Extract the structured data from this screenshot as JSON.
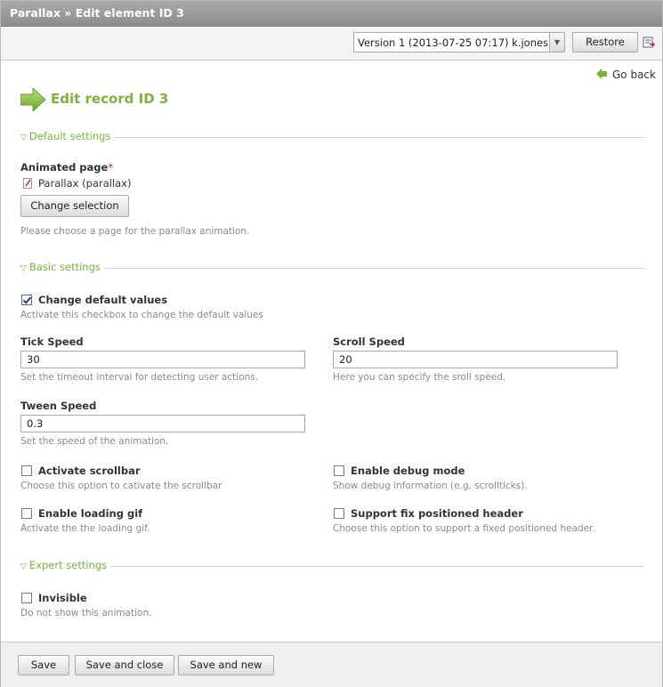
{
  "window": {
    "title": "Parallax » Edit element ID 3"
  },
  "toolbar": {
    "version_selected": "Version 1 (2013-07-25 07:17) k.jones",
    "restore_label": "Restore"
  },
  "nav": {
    "go_back": "Go back"
  },
  "page": {
    "title": "Edit record ID 3"
  },
  "sections": {
    "default": "Default settings",
    "basic": "Basic settings",
    "expert": "Expert settings"
  },
  "fields": {
    "animated_page": {
      "label": "Animated page",
      "required_mark": "*",
      "value": "Parallax (parallax)",
      "button": "Change selection",
      "help": "Please choose a page for the parallax animation."
    },
    "change_defaults": {
      "label": "Change default values",
      "checked": true,
      "help": "Activate this checkbox to change the default values"
    },
    "tick_speed": {
      "label": "Tick Speed",
      "value": "30",
      "help": "Set the timeout interval for detecting user actions."
    },
    "scroll_speed": {
      "label": "Scroll Speed",
      "value": "20",
      "help": "Here you can specify the sroll speed."
    },
    "tween_speed": {
      "label": "Tween Speed",
      "value": "0.3",
      "help": "Set the speed of the animation."
    },
    "scrollbar": {
      "label": "Activate scrollbar",
      "checked": false,
      "help": "Choose this option to cativate the scrollbar"
    },
    "debug": {
      "label": "Enable debug mode",
      "checked": false,
      "help": "Show debug information (e.g. scrollticks)."
    },
    "loading_gif": {
      "label": "Enable loading gif",
      "checked": false,
      "help": "Activate the the loading gif."
    },
    "fix_header": {
      "label": "Support fix positioned header",
      "checked": false,
      "help": "Choose this option to support a fixed positioned header."
    },
    "invisible": {
      "label": "Invisible",
      "checked": false,
      "help": "Do not show this animation."
    }
  },
  "footer": {
    "save": "Save",
    "save_close": "Save and close",
    "save_new": "Save and new"
  },
  "colors": {
    "accent_green": "#7ab33b",
    "required_red": "#cc2222"
  }
}
